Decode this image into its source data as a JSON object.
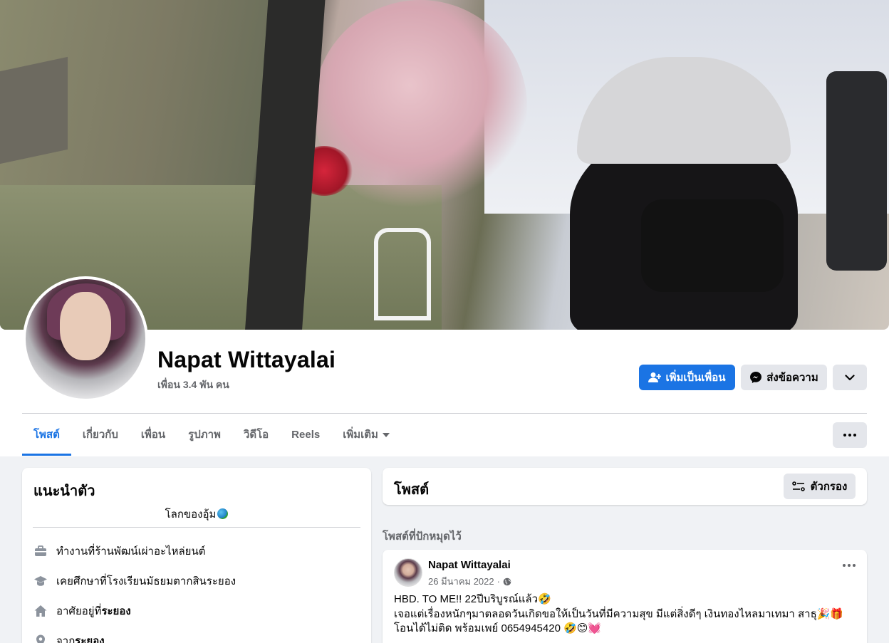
{
  "profile": {
    "name": "Napat Wittayalai",
    "friends_count": "เพื่อน 3.4 พัน คน"
  },
  "actions": {
    "add_friend": "เพิ่มเป็นเพื่อน",
    "message": "ส่งข้อความ"
  },
  "tabs": [
    {
      "label": "โพสต์",
      "active": true
    },
    {
      "label": "เกี่ยวกับ"
    },
    {
      "label": "เพื่อน"
    },
    {
      "label": "รูปภาพ"
    },
    {
      "label": "วิดีโอ"
    },
    {
      "label": "Reels"
    },
    {
      "label": "เพิ่มเติม"
    }
  ],
  "intro": {
    "title": "แนะนำตัว",
    "bio": "โลกของอุ้ม",
    "details": [
      {
        "icon": "briefcase-icon",
        "prefix": "ทำงานที่ ",
        "value": "ร้านพัฒน์เผ่าอะไหล่ยนต์",
        "bold": false
      },
      {
        "icon": "graduation-cap-icon",
        "prefix": "เคยศึกษาที่ ",
        "value": "โรงเรียนมัธยมตากสินระยอง",
        "bold": false
      },
      {
        "icon": "home-icon",
        "prefix": "อาศัยอยู่ที่ ",
        "value": "ระยอง",
        "bold": true
      },
      {
        "icon": "location-pin-icon",
        "prefix": "จาก ",
        "value": "ระยอง",
        "bold": true
      }
    ]
  },
  "posts": {
    "title": "โพสต์",
    "filter_label": "ตัวกรอง",
    "pinned_label": "โพสต์ที่ปักหมุดไว้"
  },
  "post": {
    "author": "Napat Wittayalai",
    "date": "26 มีนาคม 2022",
    "privacy_icon": "globe-icon",
    "lines": [
      "HBD. TO ME!! 22ปีบริบูรณ์แล้ว🤣",
      "เจอแต่เรื่องหนักๆมาตลอดวันเกิดขอให้เป็นวันที่มีความสุข มีแต่สิ่งดีๆ เงินทองไหลมาเทมา สาธุ🎉🎁",
      "โอนได้ไม่ติด พร้อมเพย์ 0654945420 🤣😊💓"
    ]
  },
  "colors": {
    "primary": "#1b74e4",
    "background": "#f0f2f5",
    "secondary_button": "#e4e6eb",
    "muted_text": "#65676b"
  }
}
